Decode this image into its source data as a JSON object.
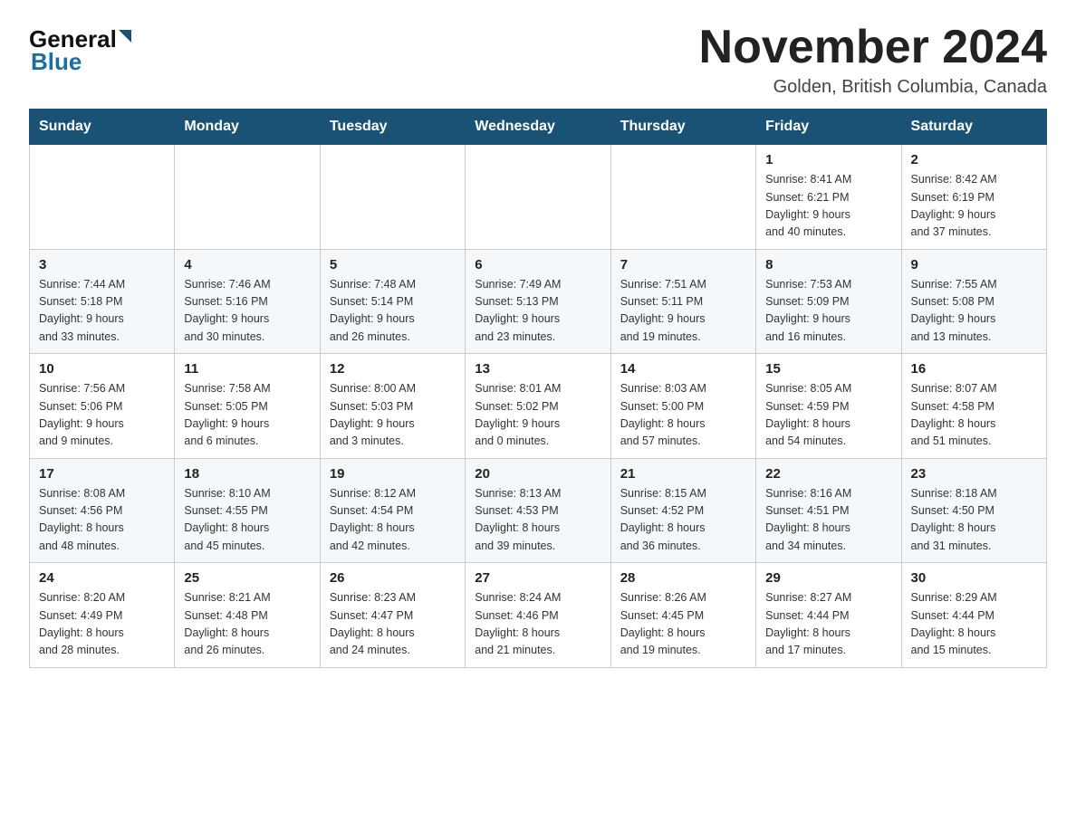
{
  "header": {
    "logo_general": "General",
    "logo_blue": "Blue",
    "title": "November 2024",
    "location": "Golden, British Columbia, Canada"
  },
  "weekdays": [
    "Sunday",
    "Monday",
    "Tuesday",
    "Wednesday",
    "Thursday",
    "Friday",
    "Saturday"
  ],
  "weeks": [
    [
      {
        "day": "",
        "info": ""
      },
      {
        "day": "",
        "info": ""
      },
      {
        "day": "",
        "info": ""
      },
      {
        "day": "",
        "info": ""
      },
      {
        "day": "",
        "info": ""
      },
      {
        "day": "1",
        "info": "Sunrise: 8:41 AM\nSunset: 6:21 PM\nDaylight: 9 hours\nand 40 minutes."
      },
      {
        "day": "2",
        "info": "Sunrise: 8:42 AM\nSunset: 6:19 PM\nDaylight: 9 hours\nand 37 minutes."
      }
    ],
    [
      {
        "day": "3",
        "info": "Sunrise: 7:44 AM\nSunset: 5:18 PM\nDaylight: 9 hours\nand 33 minutes."
      },
      {
        "day": "4",
        "info": "Sunrise: 7:46 AM\nSunset: 5:16 PM\nDaylight: 9 hours\nand 30 minutes."
      },
      {
        "day": "5",
        "info": "Sunrise: 7:48 AM\nSunset: 5:14 PM\nDaylight: 9 hours\nand 26 minutes."
      },
      {
        "day": "6",
        "info": "Sunrise: 7:49 AM\nSunset: 5:13 PM\nDaylight: 9 hours\nand 23 minutes."
      },
      {
        "day": "7",
        "info": "Sunrise: 7:51 AM\nSunset: 5:11 PM\nDaylight: 9 hours\nand 19 minutes."
      },
      {
        "day": "8",
        "info": "Sunrise: 7:53 AM\nSunset: 5:09 PM\nDaylight: 9 hours\nand 16 minutes."
      },
      {
        "day": "9",
        "info": "Sunrise: 7:55 AM\nSunset: 5:08 PM\nDaylight: 9 hours\nand 13 minutes."
      }
    ],
    [
      {
        "day": "10",
        "info": "Sunrise: 7:56 AM\nSunset: 5:06 PM\nDaylight: 9 hours\nand 9 minutes."
      },
      {
        "day": "11",
        "info": "Sunrise: 7:58 AM\nSunset: 5:05 PM\nDaylight: 9 hours\nand 6 minutes."
      },
      {
        "day": "12",
        "info": "Sunrise: 8:00 AM\nSunset: 5:03 PM\nDaylight: 9 hours\nand 3 minutes."
      },
      {
        "day": "13",
        "info": "Sunrise: 8:01 AM\nSunset: 5:02 PM\nDaylight: 9 hours\nand 0 minutes."
      },
      {
        "day": "14",
        "info": "Sunrise: 8:03 AM\nSunset: 5:00 PM\nDaylight: 8 hours\nand 57 minutes."
      },
      {
        "day": "15",
        "info": "Sunrise: 8:05 AM\nSunset: 4:59 PM\nDaylight: 8 hours\nand 54 minutes."
      },
      {
        "day": "16",
        "info": "Sunrise: 8:07 AM\nSunset: 4:58 PM\nDaylight: 8 hours\nand 51 minutes."
      }
    ],
    [
      {
        "day": "17",
        "info": "Sunrise: 8:08 AM\nSunset: 4:56 PM\nDaylight: 8 hours\nand 48 minutes."
      },
      {
        "day": "18",
        "info": "Sunrise: 8:10 AM\nSunset: 4:55 PM\nDaylight: 8 hours\nand 45 minutes."
      },
      {
        "day": "19",
        "info": "Sunrise: 8:12 AM\nSunset: 4:54 PM\nDaylight: 8 hours\nand 42 minutes."
      },
      {
        "day": "20",
        "info": "Sunrise: 8:13 AM\nSunset: 4:53 PM\nDaylight: 8 hours\nand 39 minutes."
      },
      {
        "day": "21",
        "info": "Sunrise: 8:15 AM\nSunset: 4:52 PM\nDaylight: 8 hours\nand 36 minutes."
      },
      {
        "day": "22",
        "info": "Sunrise: 8:16 AM\nSunset: 4:51 PM\nDaylight: 8 hours\nand 34 minutes."
      },
      {
        "day": "23",
        "info": "Sunrise: 8:18 AM\nSunset: 4:50 PM\nDaylight: 8 hours\nand 31 minutes."
      }
    ],
    [
      {
        "day": "24",
        "info": "Sunrise: 8:20 AM\nSunset: 4:49 PM\nDaylight: 8 hours\nand 28 minutes."
      },
      {
        "day": "25",
        "info": "Sunrise: 8:21 AM\nSunset: 4:48 PM\nDaylight: 8 hours\nand 26 minutes."
      },
      {
        "day": "26",
        "info": "Sunrise: 8:23 AM\nSunset: 4:47 PM\nDaylight: 8 hours\nand 24 minutes."
      },
      {
        "day": "27",
        "info": "Sunrise: 8:24 AM\nSunset: 4:46 PM\nDaylight: 8 hours\nand 21 minutes."
      },
      {
        "day": "28",
        "info": "Sunrise: 8:26 AM\nSunset: 4:45 PM\nDaylight: 8 hours\nand 19 minutes."
      },
      {
        "day": "29",
        "info": "Sunrise: 8:27 AM\nSunset: 4:44 PM\nDaylight: 8 hours\nand 17 minutes."
      },
      {
        "day": "30",
        "info": "Sunrise: 8:29 AM\nSunset: 4:44 PM\nDaylight: 8 hours\nand 15 minutes."
      }
    ]
  ]
}
